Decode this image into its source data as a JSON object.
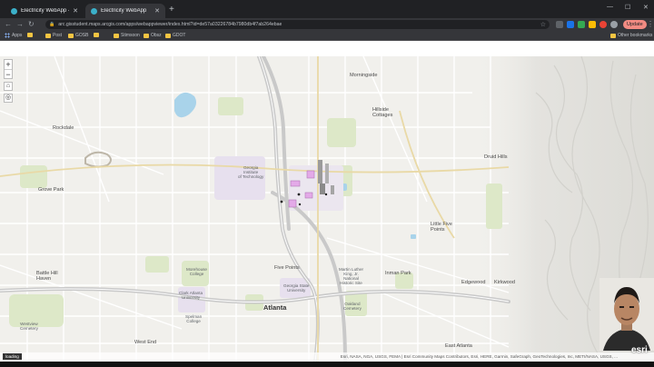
{
  "browser": {
    "tabs": [
      {
        "label": "Electricity WebApp - ArcGIS W..."
      },
      {
        "label": "Electricity WebApp"
      }
    ],
    "new_tab": "+",
    "url": "arc.gisstudent.maps.arcgis.com/apps/webappviewer/index.html?id=de57a03226784b7980db4f7ab264ebae",
    "update_label": "Update",
    "bookmarks": [
      {
        "label": "Apps",
        "kind": "grid"
      },
      {
        "label": "",
        "kind": "folder"
      },
      {
        "label": "Post",
        "kind": "folder"
      },
      {
        "label": "GOSB",
        "kind": "folder"
      },
      {
        "label": "",
        "kind": "folder"
      },
      {
        "label": "Stimsoon",
        "kind": "folder"
      },
      {
        "label": "Obsz",
        "kind": "folder"
      },
      {
        "label": "GDOT",
        "kind": "folder"
      }
    ],
    "other_bookmarks": "Other bookmarks"
  },
  "map": {
    "zoom_in": "+",
    "zoom_out": "−",
    "labels": {
      "atlanta": "Atlanta",
      "morningside": "Morningside",
      "hillside": "Hillside\nCottages",
      "druid_hills": "Druid Hills",
      "little_five_points": "Little Five\nPoints",
      "edgewood": "Edgewood",
      "kirkwood": "Kirkwood",
      "inman_park": "Inman Park",
      "five_points": "Five Points",
      "grove_park": "Grove Park",
      "rockdale": "Rockdale",
      "battle_hill": "Battle Hill\nHaven",
      "west_end": "West End",
      "east_atlanta": "East Atlanta",
      "georgia_tech": "Georgia\nInstitute\nof Technology",
      "gsu": "Georgia State\nUniversity",
      "mlk": "Martin Luther\nKing, Jr.\nNational\nHistoric Site",
      "clark": "Clark Atlanta\nUniversity",
      "morehouse": "Morehouse\nCollege",
      "spelman": "Spelman\nCollege",
      "westview": "Westview\nCemetery",
      "oakland": "Oakland\nCemetery"
    },
    "attribution": "Esri, NASA, NGA, USGS, FEMA | Esri Community Maps Contributors, Esri, HERE, Garmin, SafeGraph, GeoTechnologies, Inc, METI/NASA, USGS, ...",
    "loading": "loading",
    "esri_logo": "esri"
  },
  "colors": {
    "map_bg": "#f1f0ec",
    "park": "#dde8c8",
    "water": "#a9d3ea",
    "campus": "#e7e0ee",
    "highway": "#c9c9c9",
    "feature_pink": "#e3a9e8",
    "feature_gray": "#9b9b9b"
  }
}
